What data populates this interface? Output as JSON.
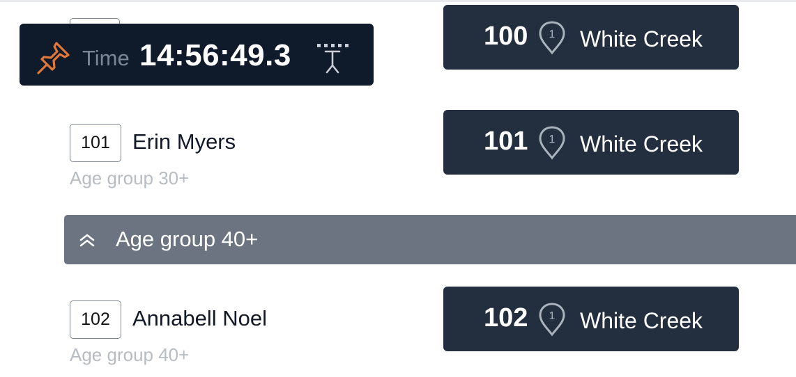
{
  "time_popup": {
    "label": "Time",
    "value": "14:56:49.3",
    "pin_icon": "pushpin-icon",
    "split_icon": "split-antenna-icon",
    "pin_color": "#e0783a"
  },
  "cards": [
    {
      "bib": "100",
      "marker_number": "1",
      "location": "White Creek"
    },
    {
      "bib": "101",
      "marker_number": "1",
      "location": "White Creek"
    },
    {
      "bib": "102",
      "marker_number": "1",
      "location": "White Creek"
    }
  ],
  "participants": [
    {
      "bib": "101",
      "name": "Erin Myers",
      "age_group": "Age group 30+"
    },
    {
      "bib": "102",
      "name": "Annabell Noel",
      "age_group": "Age group 40+"
    }
  ],
  "group_header": {
    "title": "Age group 40+",
    "icon": "chevron-double-up-icon"
  },
  "colors": {
    "card_bg": "#232f3e",
    "popup_bg": "#0f1a2a",
    "group_header_bg": "#6b7480"
  }
}
